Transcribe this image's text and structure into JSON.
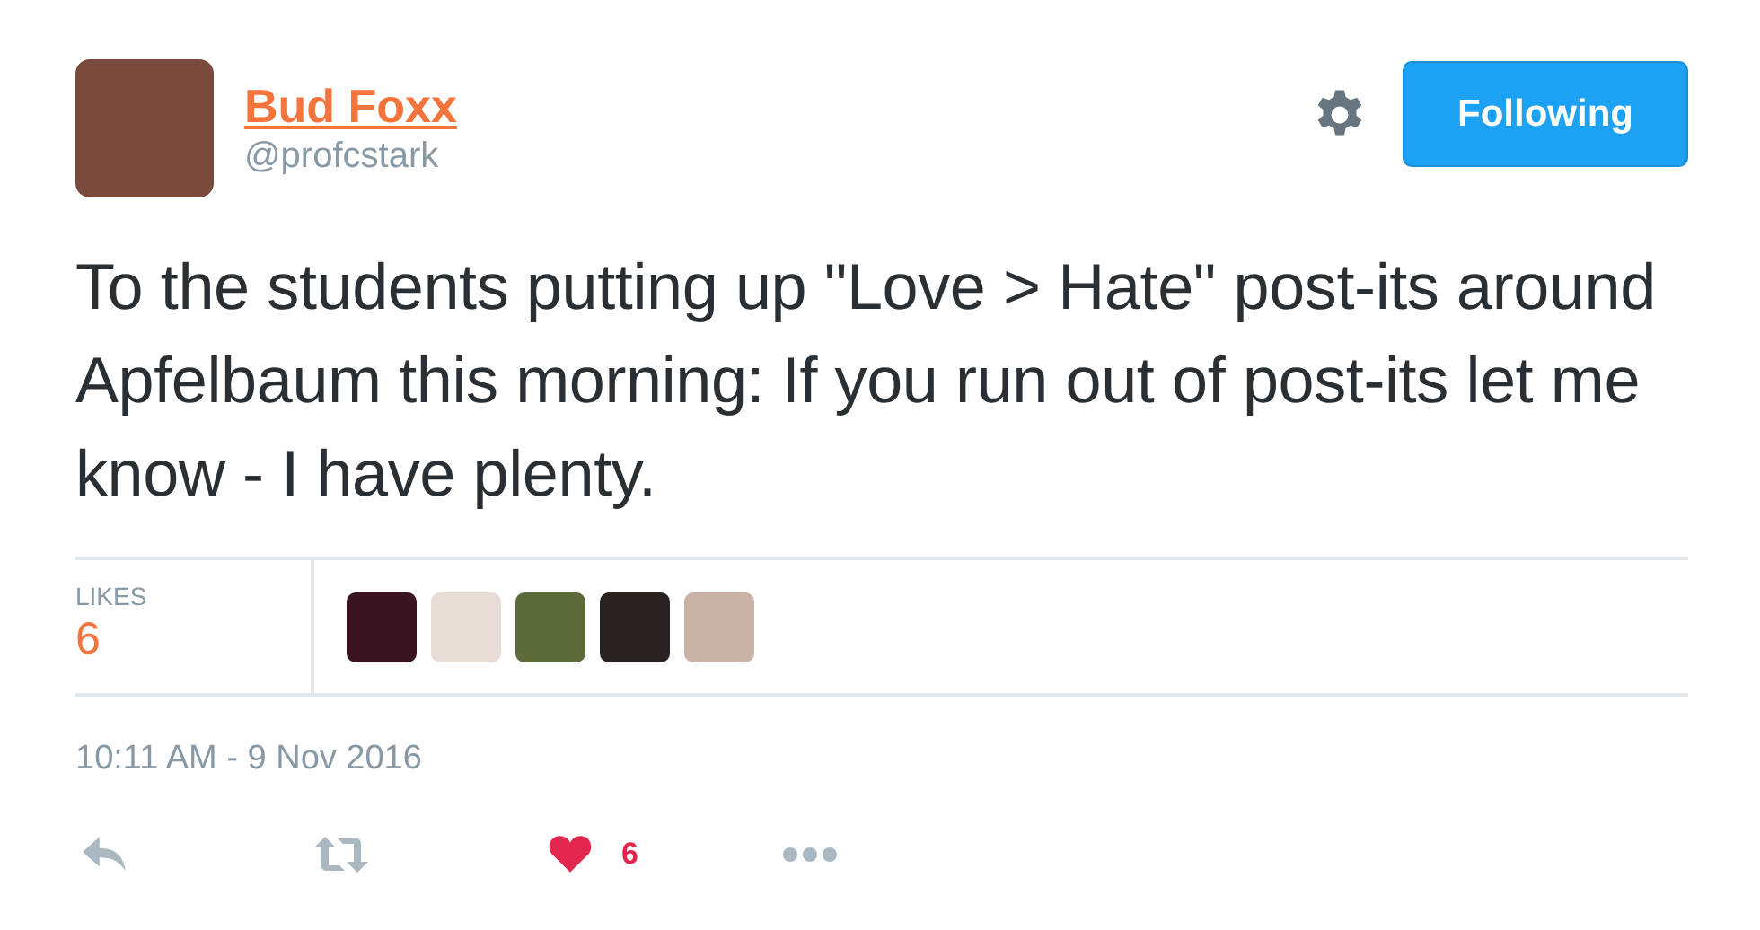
{
  "author": {
    "name": "Bud Foxx",
    "handle": "@profcstark"
  },
  "follow_button": {
    "label": "Following",
    "following": true
  },
  "tweet": {
    "text": "To the students putting up \"Love > Hate\" post-its around Apfelbaum this morning: If you run out of post-its let me know - I have plenty."
  },
  "likes": {
    "label": "LIKES",
    "count": "6",
    "avatars": [
      {
        "color": "#3a1420"
      },
      {
        "color": "#e8ddd6"
      },
      {
        "color": "#5d6a3a"
      },
      {
        "color": "#2a2220"
      },
      {
        "color": "#c9b2a6"
      }
    ]
  },
  "timestamp": "10:11 AM - 9 Nov 2016",
  "actions": {
    "liked": true,
    "like_count": "6"
  }
}
